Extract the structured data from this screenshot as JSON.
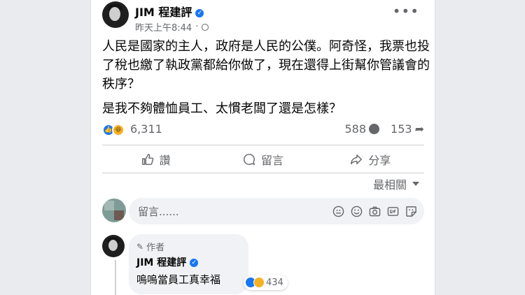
{
  "post": {
    "author": "JIM 程建評",
    "time": "昨天上午8:44",
    "meta_separator": "·",
    "paragraphs": [
      "人民是國家的主人，政府是人民的公僕。阿奇怪，我票也投了稅也繳了執政黨都給你做了，現在還得上街幫你管議會的秩序？",
      "是我不夠體恤員工、太慣老闆了還是怎樣？"
    ],
    "reaction_count": "6,311",
    "comment_count": "588",
    "share_count": "153"
  },
  "actions": {
    "like": "讚",
    "comment": "留言",
    "share": "分享"
  },
  "sort_label": "最相關",
  "comment_input": {
    "placeholder": "留言......"
  },
  "comment": {
    "badge": "作者",
    "author": "JIM 程建評",
    "text": "嗚嗚當員工真幸福",
    "reaction_count": "434"
  },
  "colors": {
    "accent": "#1877f2",
    "haha": "#f7b125",
    "secondary_text": "#65676b",
    "background": "#e9ebee"
  },
  "icons": [
    "verified-icon",
    "globe-icon",
    "more-icon",
    "like-icon",
    "haha-icon",
    "comment-icon",
    "share-icon",
    "emoji-icon",
    "camera-icon",
    "gif-icon",
    "sticker-icon",
    "pencil-icon"
  ]
}
